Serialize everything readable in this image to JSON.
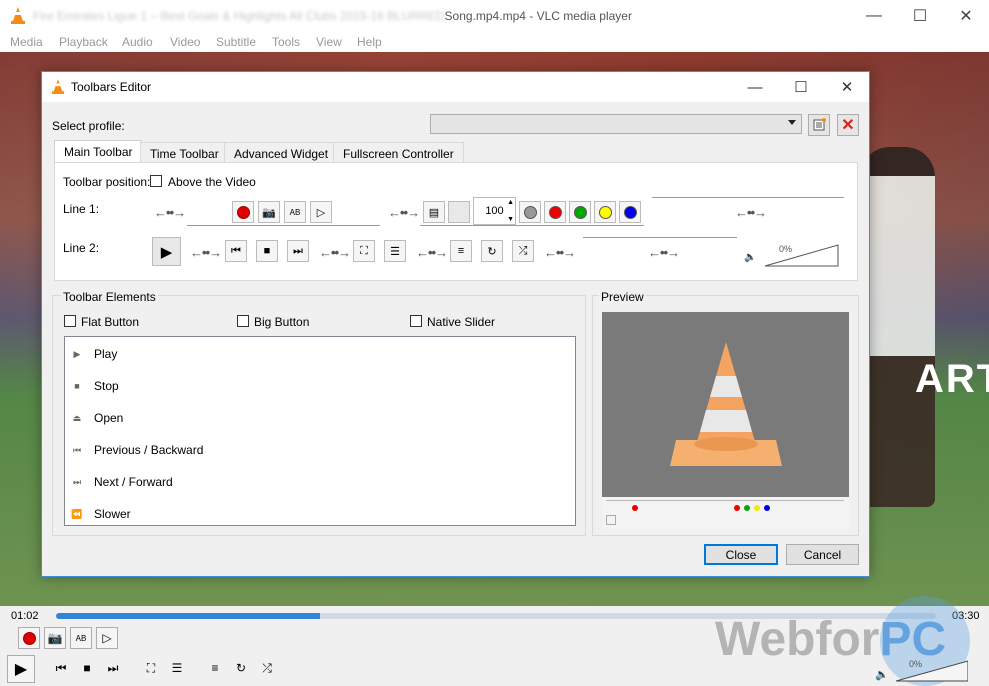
{
  "window": {
    "title_obscured": "Fire Emirates Ligue 1 – Best Goals & Highlights All Clubs 2015-16 BLURRED",
    "title_visible": "Song.mp4.mp4 - VLC media player"
  },
  "menu": [
    "Media",
    "Playback",
    "Audio",
    "Video",
    "Subtitle",
    "Tools",
    "View",
    "Help"
  ],
  "player": {
    "time_elapsed": "01:02",
    "time_total": "03:30",
    "progress": 0.3,
    "volume_percent": "0%",
    "ad_text": "ART"
  },
  "watermark": {
    "text": "Webfor",
    "accent": "PC"
  },
  "dialog": {
    "title": "Toolbars Editor",
    "profile_label": "Select profile:",
    "tabs": [
      "Main Toolbar",
      "Time Toolbar",
      "Advanced Widget",
      "Fullscreen Controller"
    ],
    "toolbar_position_label": "Toolbar position:",
    "above_video_label": "Above the Video",
    "line1_label": "Line 1:",
    "line2_label": "Line 2:",
    "speed_value": "100",
    "volume_percent": "0%",
    "elements_group_title": "Toolbar Elements",
    "flat_button_label": "Flat Button",
    "big_button_label": "Big Button",
    "native_slider_label": "Native Slider",
    "elements": [
      {
        "icon": "play-icon",
        "label": "Play"
      },
      {
        "icon": "stop-icon",
        "label": "Stop"
      },
      {
        "icon": "eject-icon",
        "label": "Open"
      },
      {
        "icon": "previous-icon",
        "label": "Previous / Backward"
      },
      {
        "icon": "next-icon",
        "label": "Next / Forward"
      },
      {
        "icon": "slower-icon",
        "label": "Slower"
      }
    ],
    "preview_title": "Preview",
    "close_label": "Close",
    "cancel_label": "Cancel"
  },
  "colors": {
    "accent": "#0078d7",
    "seek": "#2f86d9",
    "record": "#e00000",
    "cone": "#f4a460"
  }
}
